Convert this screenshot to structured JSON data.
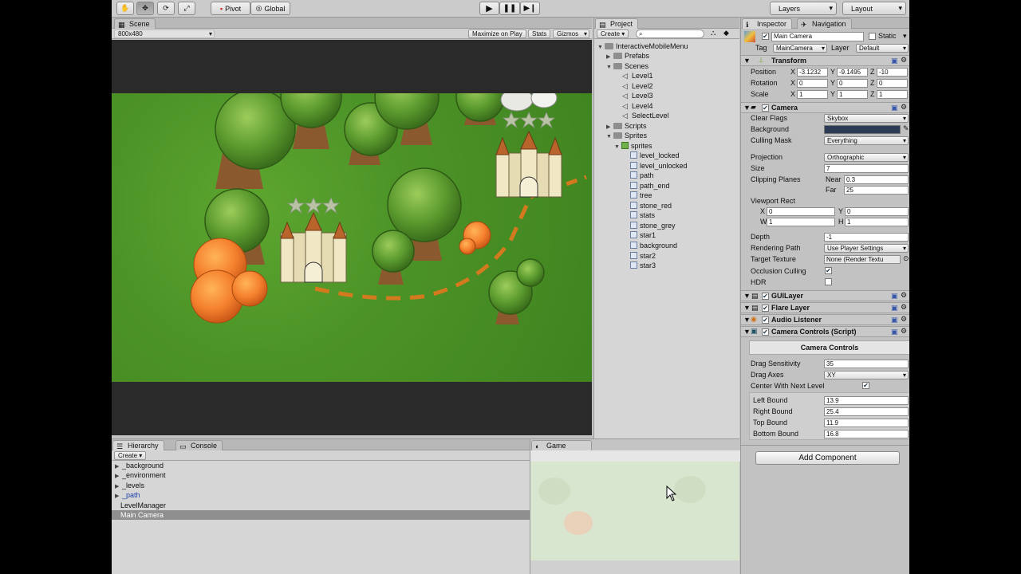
{
  "toolbar": {
    "pivot_label": "Pivot",
    "global_label": "Global",
    "layers_label": "Layers",
    "layout_label": "Layout"
  },
  "scene": {
    "tab_label": "Scene",
    "resolution": "800x480",
    "maximize_label": "Maximize on Play",
    "stats_label": "Stats",
    "gizmos_label": "Gizmos"
  },
  "project": {
    "tab_label": "Project",
    "create_label": "Create",
    "root": "InteractiveMobileMenu",
    "prefabs": "Prefabs",
    "scenes": "Scenes",
    "scene_items": [
      "Level1",
      "Level2",
      "Level3",
      "Level4",
      "SelectLevel"
    ],
    "scripts": "Scripts",
    "sprites": "Sprites",
    "sprites_sub": "sprites",
    "sprite_items": [
      "level_locked",
      "level_unlocked",
      "path",
      "path_end",
      "tree",
      "stone_red",
      "stats",
      "stone_grey",
      "star1",
      "background",
      "star2",
      "star3"
    ]
  },
  "hierarchy": {
    "tab_label": "Hierarchy",
    "console_label": "Console",
    "create_label": "Create",
    "items": [
      "_background",
      "_environment",
      "_levels",
      "_path",
      "LevelManager",
      "Main Camera"
    ]
  },
  "game": {
    "tab_label": "Game"
  },
  "inspector": {
    "tab_label": "Inspector",
    "nav_label": "Navigation",
    "object_name": "Main Camera",
    "static_label": "Static",
    "tag_label": "Tag",
    "tag_value": "MainCamera",
    "layer_label": "Layer",
    "layer_value": "Default",
    "transform": {
      "title": "Transform",
      "position_label": "Position",
      "rotation_label": "Rotation",
      "scale_label": "Scale",
      "pos": [
        "-3.1232",
        "-9.1495",
        "-10"
      ],
      "rot": [
        "0",
        "0",
        "0"
      ],
      "scl": [
        "1",
        "1",
        "1"
      ]
    },
    "camera": {
      "title": "Camera",
      "clear_flags_label": "Clear Flags",
      "clear_flags": "Skybox",
      "background_label": "Background",
      "culling_label": "Culling Mask",
      "culling": "Everything",
      "projection_label": "Projection",
      "projection": "Orthographic",
      "size_label": "Size",
      "size": "7",
      "clipping_label": "Clipping Planes",
      "near_label": "Near",
      "near": "0.3",
      "far_label": "Far",
      "far": "25",
      "viewport_label": "Viewport Rect",
      "vx": "0",
      "vy": "0",
      "vw": "1",
      "vh": "1",
      "depth_label": "Depth",
      "depth": "-1",
      "rendering_label": "Rendering Path",
      "rendering": "Use Player Settings",
      "target_label": "Target Texture",
      "target": "None (Render Textu",
      "occlusion_label": "Occlusion Culling",
      "hdr_label": "HDR"
    },
    "guilayer": "GUILayer",
    "flare": "Flare Layer",
    "audio": "Audio Listener",
    "script": {
      "title": "Camera Controls (Script)",
      "header": "Camera Controls",
      "drag_sens_label": "Drag Sensitivity",
      "drag_sens": "35",
      "drag_axes_label": "Drag Axes",
      "drag_axes": "XY",
      "center_label": "Center With Next Level",
      "left_label": "Left Bound",
      "left": "13.9",
      "right_label": "Right Bound",
      "right": "25.4",
      "top_label": "Top Bound",
      "top": "11.9",
      "bottom_label": "Bottom Bound",
      "bottom": "16.8"
    },
    "add_component": "Add Component"
  },
  "colors": {
    "grass": "#4c9327",
    "tree": "#4f8f2a",
    "stone_orange": "#f0782a",
    "path": "#d47a1e",
    "selected_row": "#8f8f8f",
    "background_swatch": "#2b3a55"
  }
}
